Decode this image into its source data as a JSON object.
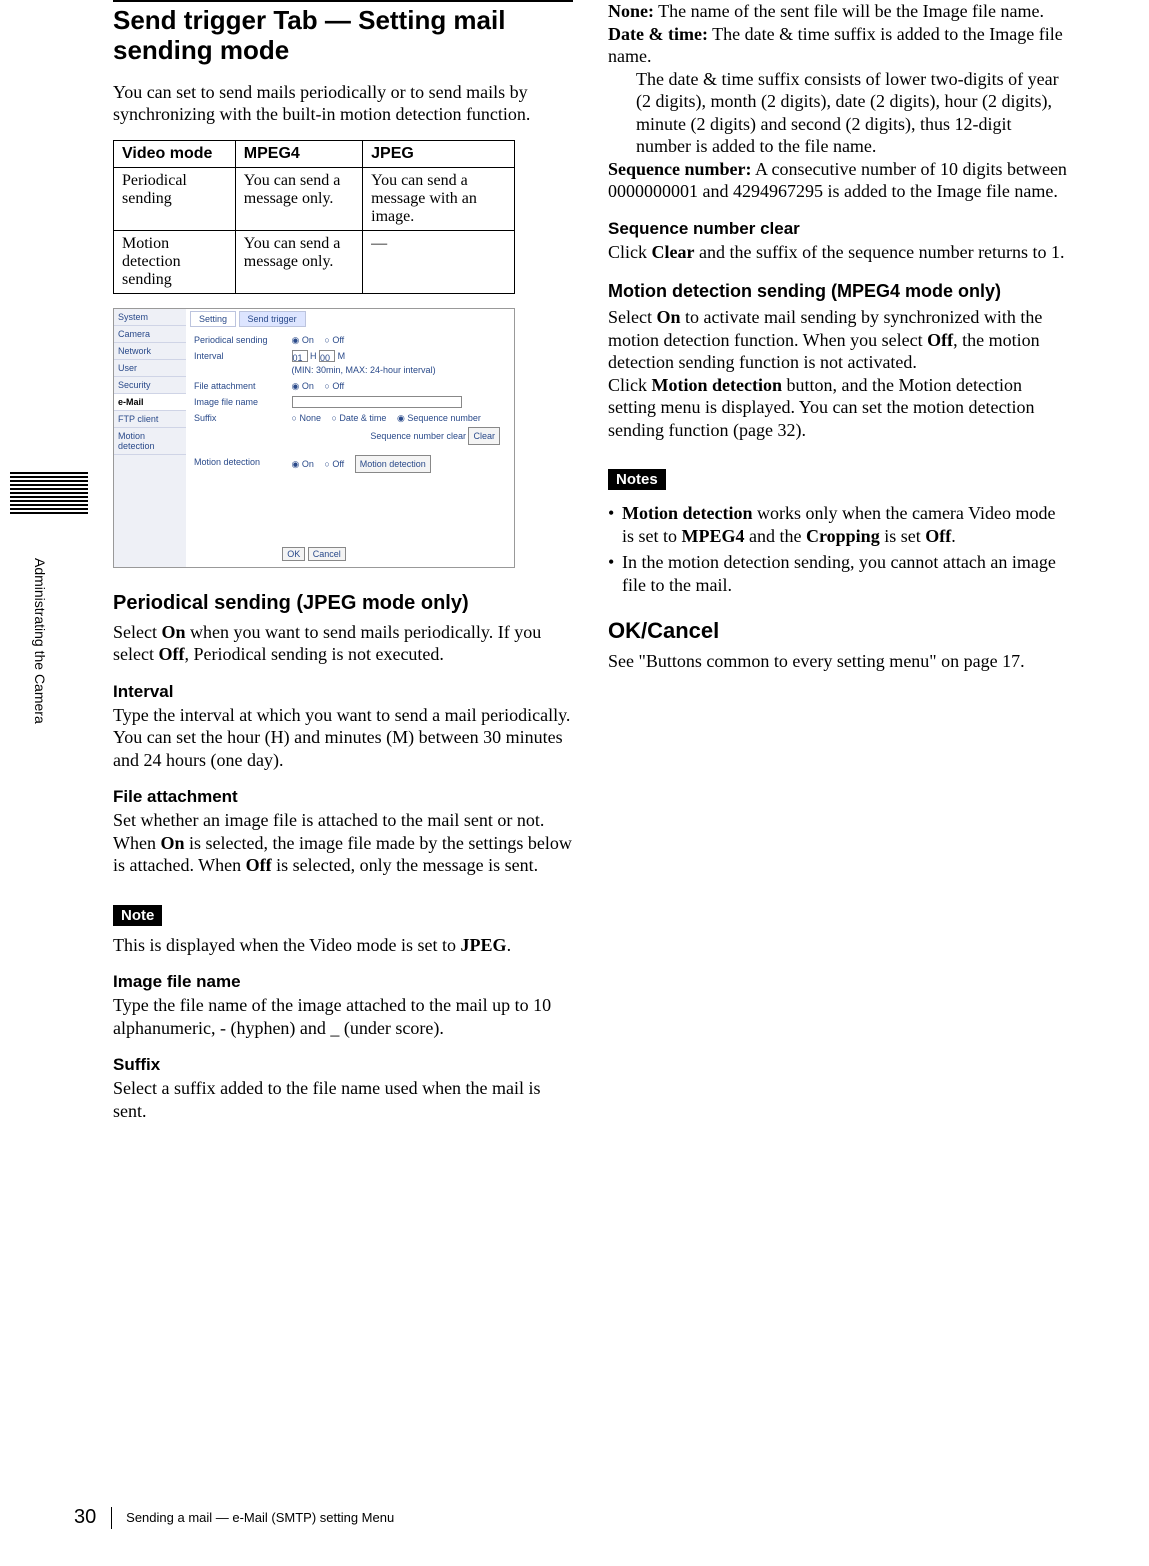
{
  "side_tab": "Administrating the Camera",
  "left": {
    "title": "Send trigger Tab — Setting mail sending mode",
    "intro": "You can set to send mails periodically or to send mails by synchronizing with the built-in motion detection function.",
    "table": {
      "h1": "Video mode",
      "h2": "MPEG4",
      "h3": "JPEG",
      "r1c1": "Periodical sending",
      "r1c2": "You can send a message only.",
      "r1c3": "You can send a message with an image.",
      "r2c1": "Motion detection sending",
      "r2c2": "You can send a message only.",
      "r2c3": "—"
    },
    "screenshot": {
      "sidebar": [
        "System",
        "Camera",
        "Network",
        "User",
        "Security",
        "e-Mail",
        "FTP client",
        "Motion detection"
      ],
      "tab_setting": "Setting",
      "tab_send": "Send trigger",
      "lbl_periodical": "Periodical sending",
      "lbl_on": "On",
      "lbl_off": "Off",
      "lbl_interval": "Interval",
      "interval_h": "01",
      "interval_m": "00",
      "interval_hint": "(MIN: 30min, MAX: 24-hour interval)",
      "lbl_fileattach": "File attachment",
      "lbl_imagefile": "Image file name",
      "lbl_suffix": "Suffix",
      "suffix_none": "None",
      "suffix_dt": "Date & time",
      "suffix_seq": "Sequence number",
      "seq_clear_lbl": "Sequence number clear",
      "btn_clear": "Clear",
      "lbl_md": "Motion detection",
      "btn_md": "Motion detection",
      "btn_ok": "OK",
      "btn_cancel": "Cancel",
      "unit_h": "H",
      "unit_m": "M"
    },
    "sec_periodical_h": "Periodical sending (JPEG mode only)",
    "sec_periodical_p": "Select On when you want to send mails periodically. If you select Off, Periodical sending is not executed.",
    "sec_interval_h": "Interval",
    "sec_interval_p": "Type the interval at which you want to send a mail periodically. You can set the hour (H) and minutes (M) between 30 minutes and 24 hours (one day).",
    "sec_fileattach_h": "File attachment",
    "sec_fileattach_p1": "Set whether an image file is attached to the mail sent or not.",
    "sec_fileattach_p2_a": "When ",
    "sec_fileattach_p2_b": "On",
    "sec_fileattach_p2_c": " is selected, the image file made by the settings below is attached. When ",
    "sec_fileattach_p2_d": "Off",
    "sec_fileattach_p2_e": " is selected, only the message is sent.",
    "note_label": "Note",
    "note_p_a": "This is displayed when the Video mode is set to ",
    "note_p_b": "JPEG",
    "note_p_c": ".",
    "sec_imgname_h": "Image file name",
    "sec_imgname_p": "Type the file name of the image attached to the mail up to 10 alphanumeric, - (hyphen) and _ (under score).",
    "sec_suffix_h": "Suffix",
    "sec_suffix_p": "Select a suffix added to the file name used when the mail is sent."
  },
  "right": {
    "def_none_t": "None:",
    "def_none_d": " The name of the sent file will be the Image file name.",
    "def_dt_t": "Date & time:",
    "def_dt_d": " The date & time suffix is added to the Image file name.",
    "def_dt_extra": "The date & time suffix consists of lower two-digits of year (2 digits), month (2 digits), date (2 digits), hour (2 digits), minute (2 digits) and second (2 digits), thus 12-digit number is added to the file name.",
    "def_seq_t": "Sequence number:",
    "def_seq_d": " A consecutive number of 10 digits between 0000000001 and 4294967295 is added to the Image file name.",
    "seqclear_h": "Sequence number clear",
    "seqclear_p_a": "Click ",
    "seqclear_p_b": "Clear",
    "seqclear_p_c": " and the suffix of the sequence number returns to 1.",
    "md_h": "Motion detection sending (MPEG4 mode only)",
    "md_p1_a": "Select ",
    "md_p1_b": "On",
    "md_p1_c": " to activate mail sending by synchronized with the motion detection function. When you select ",
    "md_p1_d": "Off",
    "md_p1_e": ", the motion detection sending function is not activated.",
    "md_p2_a": "Click ",
    "md_p2_b": "Motion detection",
    "md_p2_c": " button, and the Motion detection setting menu is displayed. You can set the motion detection sending function (page 32).",
    "notes_label": "Notes",
    "note1_a": "Motion detection",
    "note1_b": " works only when the camera Video mode is set to ",
    "note1_c": "MPEG4",
    "note1_d": " and the ",
    "note1_e": "Cropping",
    "note1_f": " is set ",
    "note1_g": "Off",
    "note1_h": ".",
    "note2": "In the motion detection sending, you cannot attach an image file to the mail.",
    "okcancel_h": "OK/Cancel",
    "okcancel_p": "See \"Buttons common to every setting menu\" on page 17."
  },
  "footer": {
    "page": "30",
    "text": "Sending a mail — e-Mail (SMTP) setting Menu"
  }
}
